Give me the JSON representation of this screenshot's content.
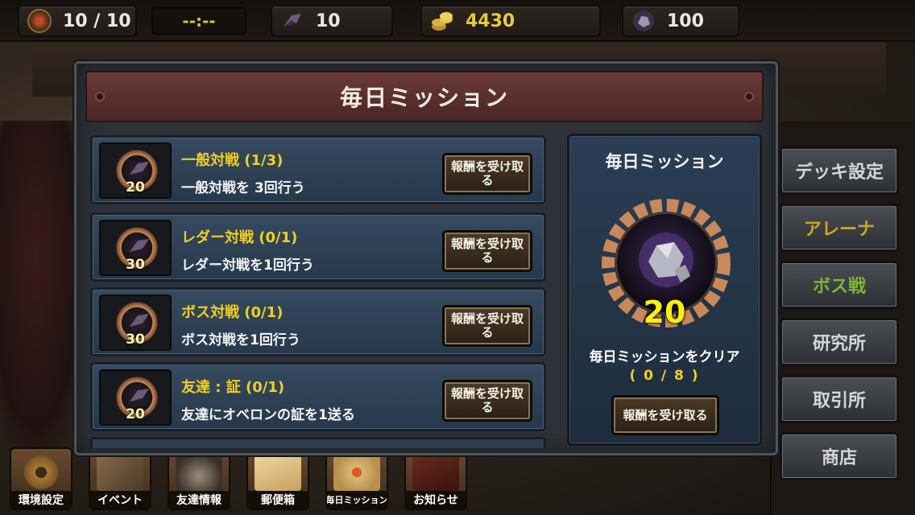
{
  "topbar": {
    "stamina": "10 / 10",
    "timer": "--:--",
    "crystals": "10",
    "gold": "4430",
    "ore": "100"
  },
  "panel": {
    "title": "毎日ミッション",
    "missions": [
      {
        "title": "一般対戦 (1/3)",
        "desc": "一般対戦を 3回行う",
        "reward": "20",
        "button": "報酬を受け取る"
      },
      {
        "title": "レダー対戦 (0/1)",
        "desc": "レダー対戦を1回行う",
        "reward": "30",
        "button": "報酬を受け取る"
      },
      {
        "title": "ボス対戦 (0/1)",
        "desc": "ボス対戦を1回行う",
        "reward": "30",
        "button": "報酬を受け取る"
      },
      {
        "title": "友達 : 証 (0/1)",
        "desc": "友達にオベロンの証を1送る",
        "reward": "20",
        "button": "報酬を受け取る"
      }
    ],
    "summary": {
      "title": "毎日ミッション",
      "reward": "20",
      "label": "毎日ミッションをクリア",
      "progress": "( 0 / 8 )",
      "button": "報酬を受け取る"
    }
  },
  "rightnav": [
    {
      "label": "デッキ設定",
      "color": "#d6d6d6"
    },
    {
      "label": "アレーナ",
      "color": "#c9a820"
    },
    {
      "label": "ボス戦",
      "color": "#7ab830"
    },
    {
      "label": "研究所",
      "color": "#d6d6d6"
    },
    {
      "label": "取引所",
      "color": "#d6d6d6"
    },
    {
      "label": "商店",
      "color": "#d6d6d6"
    }
  ],
  "bottombar": [
    {
      "label": "環境設定",
      "icon": "gear-icon"
    },
    {
      "label": "イベント",
      "icon": "event-icon"
    },
    {
      "label": "友達情報",
      "icon": "friends-icon"
    },
    {
      "label": "郵便箱",
      "icon": "mail-icon"
    },
    {
      "label": "毎日ミッション",
      "icon": "daily-mission-icon"
    },
    {
      "label": "お知らせ",
      "icon": "notice-icon"
    }
  ]
}
